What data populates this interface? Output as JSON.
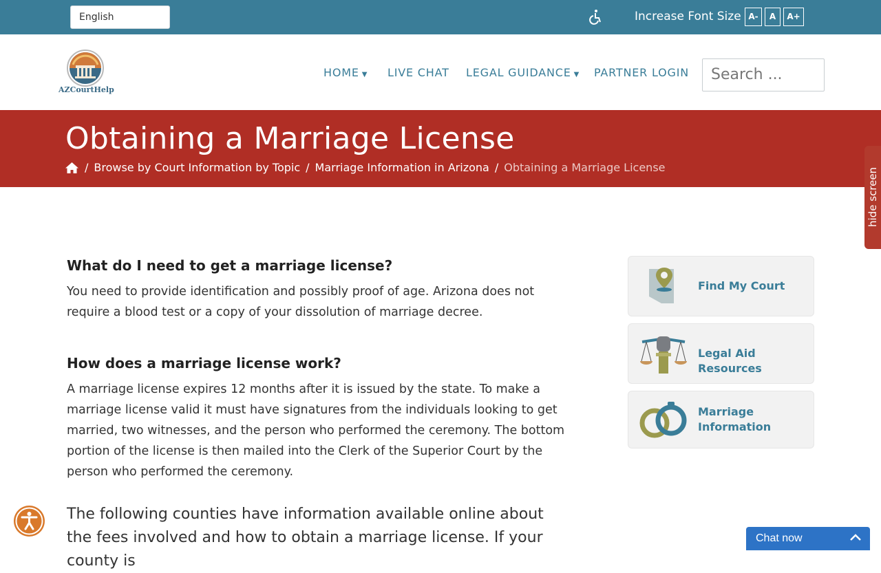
{
  "topbar": {
    "language": "English",
    "font_label": "Increase Font Size",
    "font_buttons": [
      "A-",
      "A",
      "A+"
    ]
  },
  "header": {
    "logo_text": "AZCourtHelp",
    "nav": [
      {
        "label": "HOME",
        "dropdown": true
      },
      {
        "label": "LIVE CHAT",
        "dropdown": false
      },
      {
        "label": "LEGAL GUIDANCE",
        "dropdown": true
      },
      {
        "label": "PARTNER LOGIN",
        "dropdown": false
      }
    ],
    "search_placeholder": "Search ..."
  },
  "hero": {
    "title": "Obtaining a Marriage License",
    "breadcrumb": [
      "Browse by Court Information by Topic",
      "Marriage Information in Arizona",
      "Obtaining a Marriage License"
    ],
    "separator": "/"
  },
  "hide_tab": "hide screen",
  "content": {
    "q1": "What do I need to get a marriage license?",
    "a1": "You need to provide identification and possibly proof of age.  Arizona does not require a blood test or a copy of your dissolution of marriage decree.",
    "q2": "How does a marriage license work?",
    "a2": "A marriage license expires 12 months after it is issued by the state.  To make a marriage license valid it must have signatures from the individuals looking to get married, two witnesses, and the person who performed the ceremony.  The bottom portion of the license is then mailed into the Clerk of the Superior Court by the person who performed the ceremony.",
    "p3": "The following counties have information available online about the fees involved and how to obtain a marriage license. If your county is"
  },
  "sidebar": [
    {
      "label": "Find My Court",
      "icon": "map-pin-icon"
    },
    {
      "label": "Legal Aid Resources",
      "icon": "scales-fist-icon"
    },
    {
      "label": "Marriage Information",
      "icon": "rings-icon"
    }
  ],
  "chat": {
    "label": "Chat now"
  },
  "colors": {
    "topbar": "#3a7d98",
    "hero": "#b02e25",
    "nav": "#3a7d98",
    "chat": "#2d73c6",
    "accessibility": "#d9792b"
  }
}
